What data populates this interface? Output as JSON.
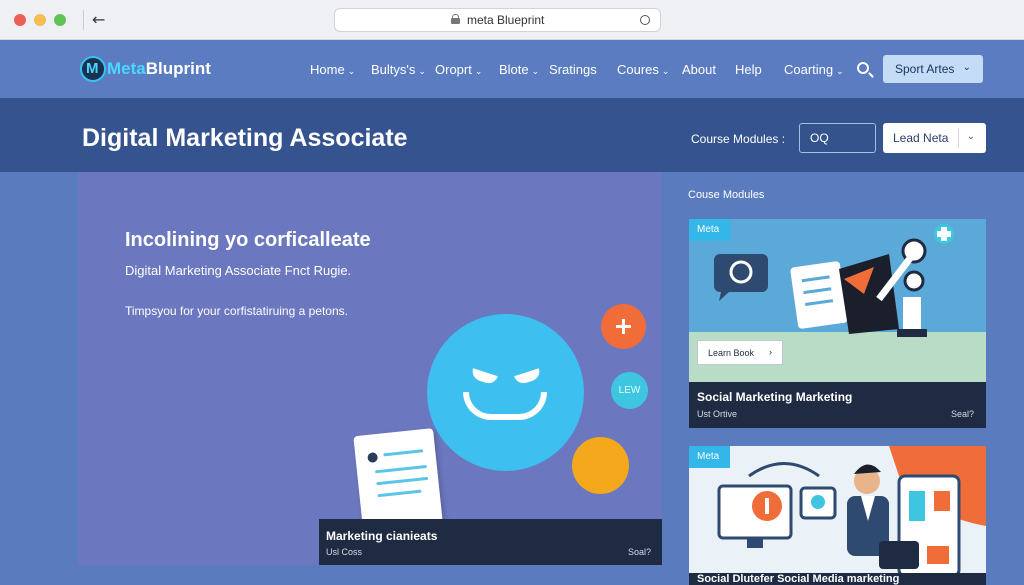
{
  "browser": {
    "url": "meta Blueprint"
  },
  "nav": {
    "brand_part1": "Meta",
    "brand_part2": "Bluprint",
    "items": [
      {
        "label": "Home",
        "chevron": true
      },
      {
        "label": "Bultys's",
        "chevron": true
      },
      {
        "label": "Oroprt",
        "chevron": true
      },
      {
        "label": "Blote",
        "chevron": true
      },
      {
        "label": "Sratings",
        "chevron": false
      },
      {
        "label": "Coures",
        "chevron": true
      },
      {
        "label": "About",
        "chevron": false
      },
      {
        "label": "Help",
        "chevron": false
      },
      {
        "label": "Coarting",
        "chevron": true
      }
    ],
    "cta_label": "Sport Artes"
  },
  "band": {
    "title": "Digital Marketing Associate",
    "course_modules_label": "Course Modules :",
    "search_value": "OQ",
    "lead_label": "Lead Neta"
  },
  "hero": {
    "heading": "Incolining yo corficalleate",
    "subheading": "Digital Marketing Associate Fnct Rugie.",
    "description": "Timpsyou for your corfistatiruing a petons.",
    "badge_text": "LEW",
    "caption_title": "Marketing cianieats",
    "caption_sub": "Usl Coss",
    "caption_right": "Soal?"
  },
  "sidebar": {
    "section_label": "Couse Modules",
    "cards": [
      {
        "badge": "Meta",
        "button": "Learn Book",
        "title": "Social Marketing Marketing",
        "sub": "Ust Ortive",
        "right": "Seal?"
      },
      {
        "badge": "Meta",
        "title": "Social Dlutefer Social Media marketing"
      }
    ]
  },
  "colors": {
    "page_bg": "#5a7bbd",
    "nav_bg": "#5b7cc0",
    "band_bg": "#35538e",
    "hero_bg": "#6b78bf",
    "accent_cyan": "#3dbff0",
    "accent_orange": "#f06d3a",
    "caption_bg": "#1f2b43"
  }
}
